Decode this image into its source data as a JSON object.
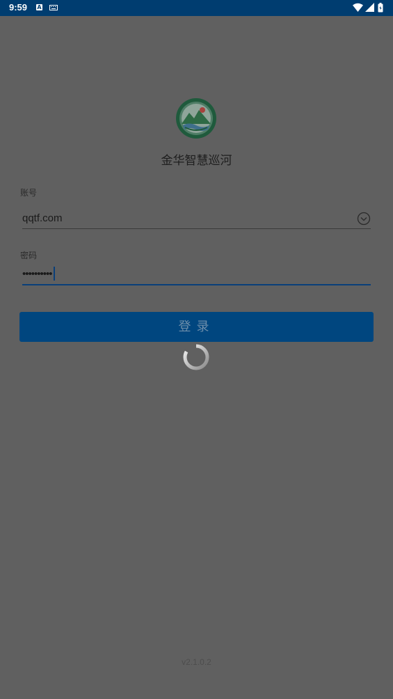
{
  "status_bar": {
    "time": "9:59",
    "notification_icons": [
      "a-icon",
      "keyboard-icon"
    ],
    "right_icons": [
      "wifi-icon",
      "signal-icon",
      "battery-icon"
    ]
  },
  "app": {
    "name": "金华智慧巡河",
    "logo_icon": "river-patrol-emblem"
  },
  "form": {
    "account_label": "账号",
    "account_value": "qqtf.com",
    "password_label": "密码",
    "password_masked": "••••••••••"
  },
  "login_button_label": "登录",
  "loading": true,
  "version": "v2.1.0.2",
  "colors": {
    "status_bar": "#003d70",
    "overlay_background": "#606060",
    "button": "#00467f",
    "accent": "#0a3f7a"
  }
}
